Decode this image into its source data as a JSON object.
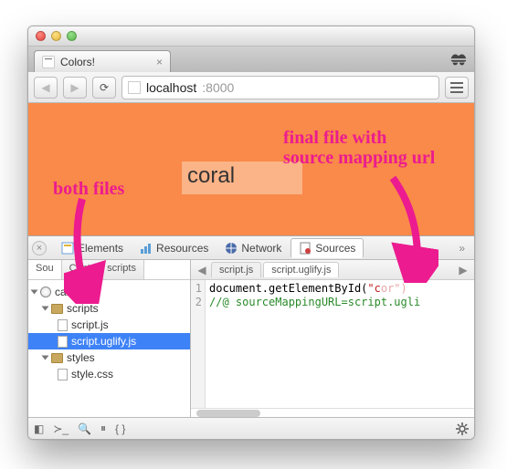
{
  "browser": {
    "tab_title": "Colors!",
    "url_host": "localhost",
    "url_port": ":8000"
  },
  "page": {
    "color_label": "coral"
  },
  "devtools": {
    "tabs": {
      "elements": "Elements",
      "resources": "Resources",
      "network": "Network",
      "sources": "Sources"
    },
    "navigator_subtabs": {
      "sources": "Sou",
      "content_scripts": "Content scripts"
    },
    "file_tree": {
      "domain": "calhost",
      "folders": {
        "scripts": "scripts",
        "styles": "styles"
      },
      "files": {
        "script_js": "script.js",
        "script_uglify_js": "script.uglify.js",
        "style_css": "style.css"
      }
    },
    "open_tabs": {
      "script_js": "script.js",
      "script_uglify_js": "script.uglify.js"
    },
    "code": {
      "line1_prefix": "document.getElementById(",
      "line1_string": "\"c",
      "line1_suffix": "or\")",
      "line2": "//@ sourceMappingURL=script.ugli"
    },
    "gutter": {
      "l1": "1",
      "l2": "2"
    }
  },
  "annotations": {
    "both_files": "both files",
    "final_file_line1": "final file with",
    "final_file_line2": "source mapping url"
  }
}
